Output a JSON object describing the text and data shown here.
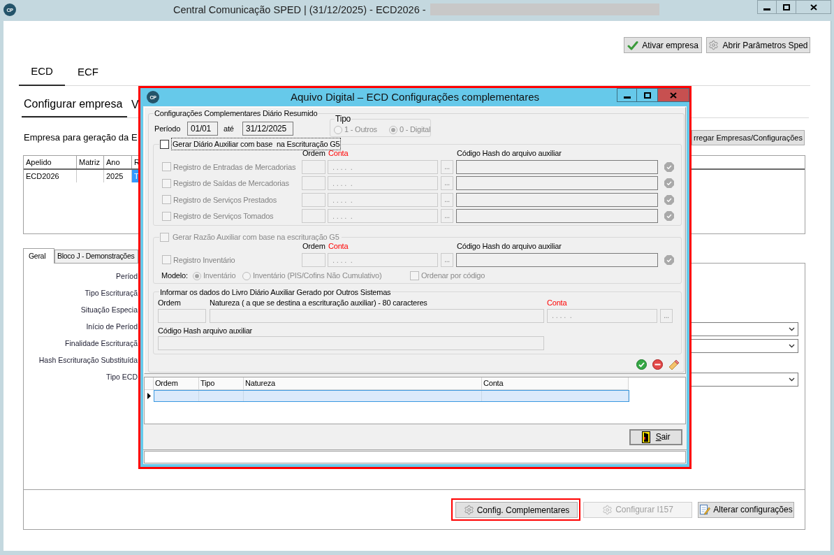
{
  "window": {
    "logo_text": "CP",
    "title": "Central Comunicação SPED | (31/12/2025) - ECD2026 -"
  },
  "header_buttons": [
    {
      "label": "Ativar empresa",
      "kind": "activate"
    },
    {
      "label": "Abrir Parâmetros Sped",
      "kind": "settings"
    }
  ],
  "module_tabs": [
    {
      "label": "ECD",
      "selected": true
    },
    {
      "label": "ECF",
      "selected": false
    }
  ],
  "section_tabs": [
    {
      "label": "Configurar empresa",
      "selected": true
    },
    {
      "label": "V",
      "selected": false
    }
  ],
  "company_prompt": "Empresa para geração da E",
  "load_button": {
    "label": "rregar Empresas/Configurações"
  },
  "company_table": {
    "columns": [
      "Apelido",
      "Matriz",
      "Ano",
      "R"
    ],
    "rows": [
      {
        "cells": [
          {
            "text": "ECD2026",
            "selected": false
          },
          {
            "selected": false
          },
          {
            "text": "2025",
            "selected": false
          },
          {
            "text": "T",
            "selected": true
          }
        ]
      }
    ]
  },
  "detail_tabs": [
    {
      "label": "Geral",
      "selected": true
    },
    {
      "label": "Bloco J - Demonstrações",
      "selected": false
    }
  ],
  "detail_fields": [
    {
      "label": "Períod",
      "kind": "label"
    },
    {
      "label": "Tipo Escrituraçã",
      "kind": "label"
    },
    {
      "label": "Situação Especia",
      "kind": "label"
    },
    {
      "label": "Início de Períod",
      "kind": "dropdown"
    },
    {
      "label": "Finalidade Escrituraçã",
      "kind": "dropdown"
    },
    {
      "label": "Hash Escrituração Substituída",
      "kind": "label"
    },
    {
      "label": "Tipo ECD",
      "kind": "dropdown"
    }
  ],
  "footer_buttons": [
    {
      "label": "Config. Complementares",
      "kind": "settings",
      "disabled": false,
      "highlighted": true
    },
    {
      "label": "Configurar I157",
      "kind": "settings",
      "disabled": true,
      "highlighted": false
    },
    {
      "label": "Alterar configurações",
      "kind": "edit",
      "disabled": false,
      "highlighted": false
    }
  ],
  "dialog": {
    "logo_text": "CP",
    "title": "Aquivo Digital – ECD Configurações complementares",
    "highlighted": true,
    "legend": "Configurações Complementares Diário Resumido",
    "period_label": "Período",
    "period_start": "01/01",
    "until_label": "até",
    "period_end": "31/12/2025",
    "type_group": {
      "legend": "Tipo",
      "disabled": true,
      "options": [
        {
          "label": "1 - Outros",
          "selected": false
        },
        {
          "label": "0 - Digital",
          "selected": true
        }
      ]
    },
    "diario_group": {
      "checkbox": {
        "label": "Gerar Diário Auxiliar com base  na Escrituração G5",
        "checked": false,
        "disabled": false,
        "focused": true
      },
      "headers": {
        "order": "Ordem",
        "account": "Conta",
        "hash": "Código Hash do arquivo auxiliar"
      },
      "rows": [
        {
          "label": "Registro de Entradas de Mercadorias",
          "checked": false,
          "disabled": true,
          "account_mask": ". . . .  .",
          "browse": "..."
        },
        {
          "label": "Registro de Saídas de Mercadorias",
          "checked": false,
          "disabled": true,
          "account_mask": ". . . .  .",
          "browse": "..."
        },
        {
          "label": "Registro de Serviços Prestados",
          "checked": false,
          "disabled": true,
          "account_mask": ". . . .  .",
          "browse": "..."
        },
        {
          "label": "Registro de Serviços Tomados",
          "checked": false,
          "disabled": true,
          "account_mask": ". . . .  .",
          "browse": "..."
        }
      ]
    },
    "razao_group": {
      "checkbox": {
        "label": "Gerar Razão Auxiliar com base na escrituração G5",
        "checked": false,
        "disabled": true,
        "focused": false
      },
      "headers": {
        "order": "Ordem",
        "account": "Conta",
        "hash": "Código Hash do arquivo auxiliar"
      },
      "rows": [
        {
          "label": "Registro Inventário",
          "checked": false,
          "disabled": true,
          "account_mask": ". . . .  .",
          "browse": "..."
        }
      ],
      "model_label": "Modelo:",
      "model_options": [
        {
          "label": "Inventário",
          "selected": true,
          "disabled": true
        },
        {
          "label": "Inventário (PIS/Cofins Não Cumulativo)",
          "selected": false,
          "disabled": true
        }
      ],
      "sort_checkbox": {
        "label": "Ordenar por código",
        "checked": false,
        "disabled": true
      }
    },
    "external_group": {
      "legend": "Informar os dados do Livro Diário Auxiliar Gerado por Outros Sistemas",
      "order_label": "Ordem",
      "nature_label": "Natureza ( a que se destina a escrituração auxiliar) - 80 caracteres",
      "account_label": "Conta",
      "account_mask": ". . . .  .",
      "browse": "...",
      "hash_label": "Código Hash arquivo auxiliar"
    },
    "grid": {
      "columns": [
        "Ordem",
        "Tipo",
        "Natureza",
        "Conta"
      ],
      "rows": [
        {
          "selected": true
        }
      ]
    },
    "exit_button": {
      "label": "Sair"
    }
  }
}
